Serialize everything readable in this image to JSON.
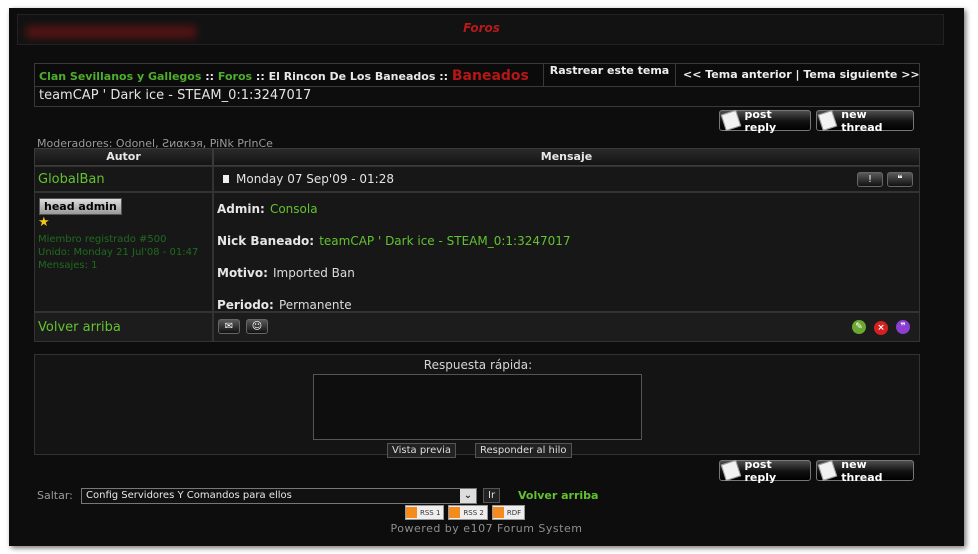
{
  "header": {
    "title": "Foros"
  },
  "breadcrumb": {
    "items": [
      "Clan Sevillanos y Gallegos",
      "Foros",
      "El Rincon De Los Baneados"
    ],
    "sep": "::",
    "current": "Baneados"
  },
  "track": "Rastrear este tema",
  "thread_nav": {
    "prev": "<< Tema anterior",
    "sep": "|",
    "next": "Tema siguiente >>"
  },
  "thread_title": "teamCAP ' Dark ice - STEAM_0:1:3247017",
  "buttons": {
    "post_reply": "post reply",
    "new_thread": "new thread"
  },
  "moderators": "Moderadores: Odonel, Ƨиαкэя, PiNk PrInCe",
  "table": {
    "col_author": "Autor",
    "col_message": "Mensaje"
  },
  "post": {
    "author": "GlobalBan",
    "date": "Monday 07 Sep'09 - 01:28",
    "rank_badge": "head admin",
    "user_info": [
      "Miembro registrado #500",
      "Unido: Monday 21 Jul'08 - 01:47",
      "Mensajes: 1"
    ],
    "fields": [
      {
        "label": "Admin:",
        "value": "Consola",
        "green": true
      },
      {
        "label": "Nick Baneado:",
        "value": "teamCAP ' Dark ice - STEAM_0:1:3247017",
        "green": true
      },
      {
        "label": "Motivo:",
        "value": "Imported Ban",
        "green": false
      },
      {
        "label": "Periodo:",
        "value": "Permanente",
        "green": false
      }
    ]
  },
  "back_to_top": "Volver arriba",
  "quick_reply": {
    "title": "Respuesta rápida:",
    "preview": "Vista previa",
    "submit": "Responder al hilo"
  },
  "jump": {
    "label": "Saltar:",
    "selected": "Config Servidores Y Comandos para ellos",
    "go": "Ir",
    "back_to_top": "Volver arriba"
  },
  "feeds": [
    {
      "label": "RSS 1"
    },
    {
      "label": "RSS 2"
    },
    {
      "label": "RDF"
    }
  ],
  "powered": "Powered by e107 Forum System",
  "colors": {
    "accent_green": "#4fae2d",
    "accent_red": "#b61616",
    "background": "#0d0d0d"
  }
}
